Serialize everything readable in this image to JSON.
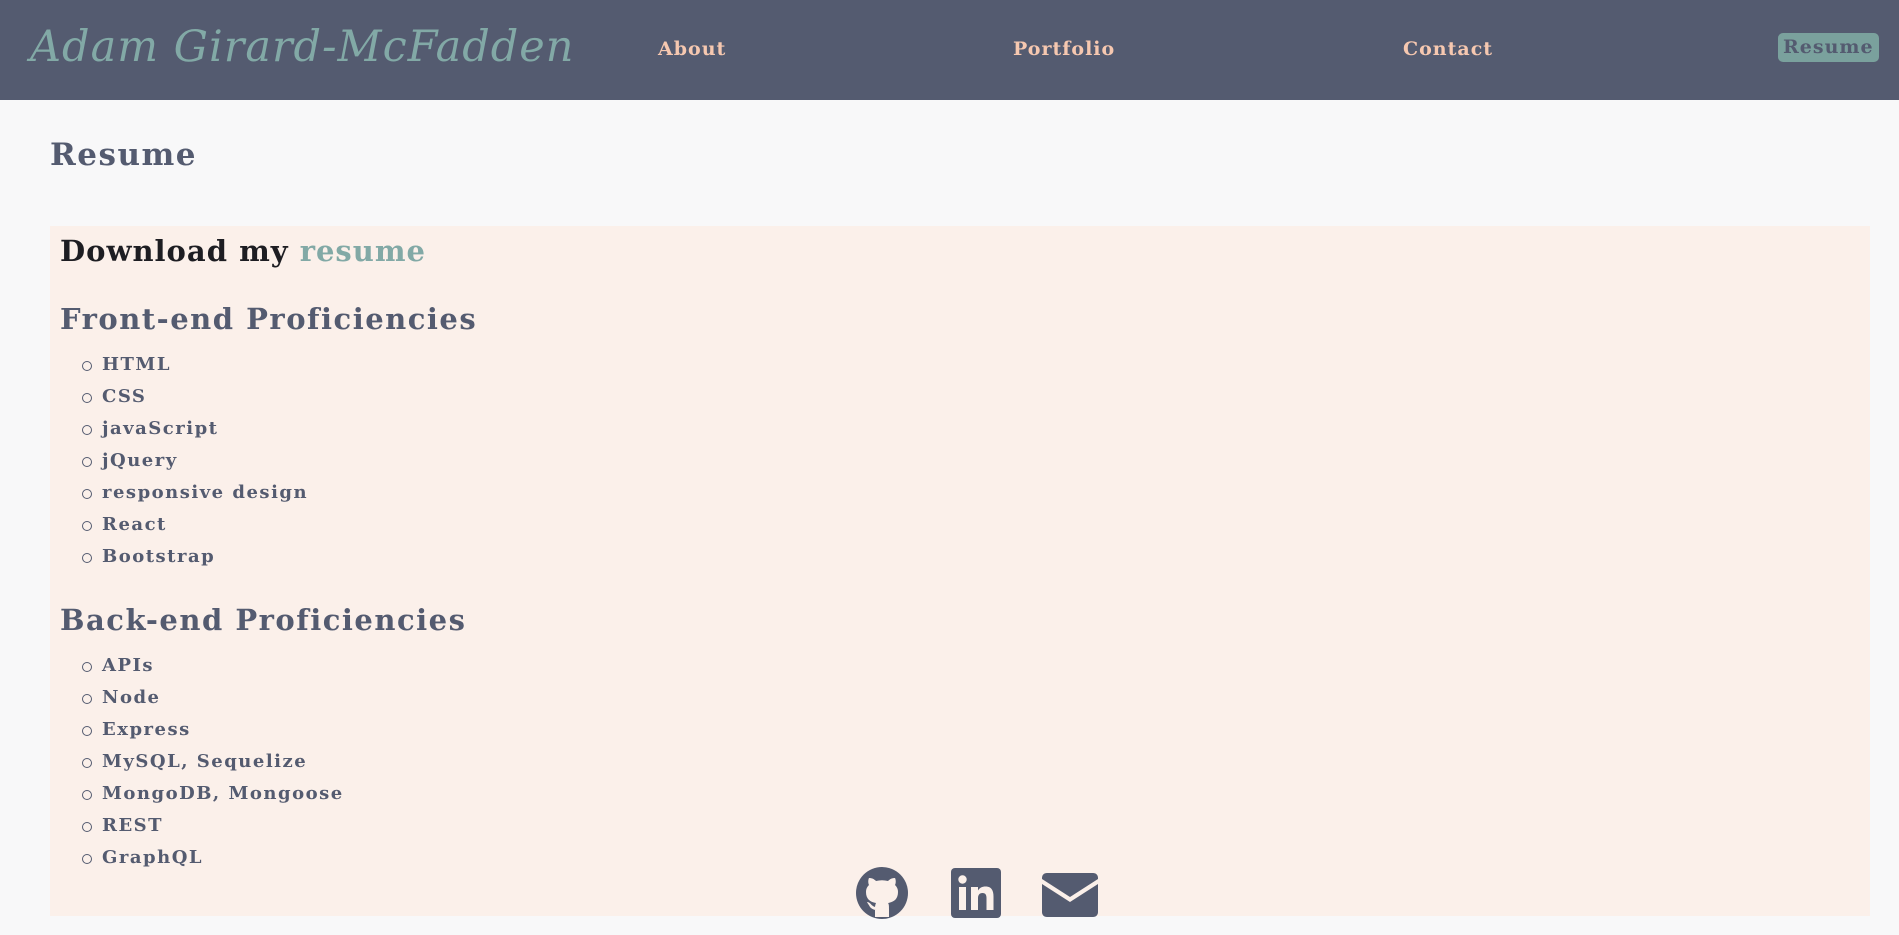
{
  "header": {
    "brand": "Adam Girard-McFadden",
    "nav": {
      "about": "About",
      "portfolio": "Portfolio",
      "contact": "Contact",
      "resume": "Resume"
    }
  },
  "main": {
    "title": "Resume",
    "download": {
      "prefix": "Download my ",
      "link": "resume"
    },
    "front_end": {
      "heading": "Front-end Proficiencies",
      "items": [
        "HTML",
        "CSS",
        "javaScript",
        "jQuery",
        "responsive design",
        "React",
        "Bootstrap"
      ]
    },
    "back_end": {
      "heading": "Back-end Proficiencies",
      "items": [
        "APIs",
        "Node",
        "Express",
        "MySQL, Sequelize",
        "MongoDB, Mongoose",
        "REST",
        "GraphQL"
      ]
    }
  },
  "footer": {
    "icons": [
      "github-icon",
      "linkedin-icon",
      "mail-icon"
    ]
  },
  "colors": {
    "header_bg": "#545b70",
    "brand": "#82a9a6",
    "nav_link": "#f6c8b0",
    "card_bg": "#fbf0ea",
    "page_bg": "#f8f8f9"
  }
}
